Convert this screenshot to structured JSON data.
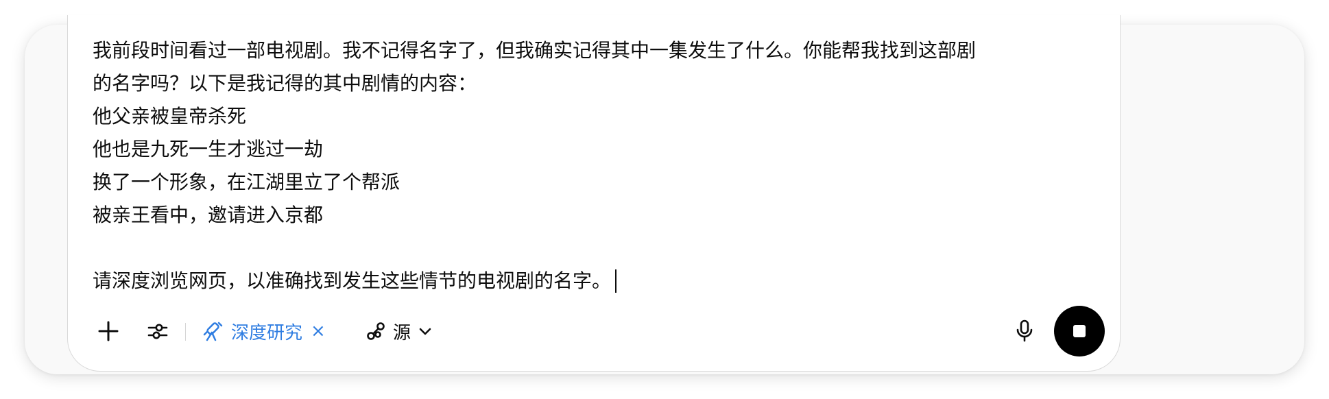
{
  "composer": {
    "prompt_lines": [
      "我前段时间看过一部电视剧。我不记得名字了，但我确实记得其中一集发生了什么。你能帮我找到这部剧",
      "的名字吗？以下是我记得的其中剧情的内容：",
      "他父亲被皇帝杀死",
      "他也是九死一生才逃过一劫",
      "换了一个形象，在江湖里立了个帮派",
      "被亲王看中，邀请进入京都",
      "",
      "请深度浏览网页，以准确找到发生这些情节的电视剧的名字。"
    ]
  },
  "toolbar": {
    "add_icon": "plus-icon",
    "tools_icon": "sliders-icon",
    "mode_chip": {
      "label": "深度研究",
      "icon": "telescope-icon",
      "close_glyph": "×",
      "color": "#2f7de1"
    },
    "sources": {
      "label": "源",
      "icon": "link-icon",
      "chevron_icon": "chevron-down-icon"
    },
    "mic_icon": "microphone-icon",
    "stop_icon": "stop-icon",
    "stop_button_color": "#000000"
  }
}
